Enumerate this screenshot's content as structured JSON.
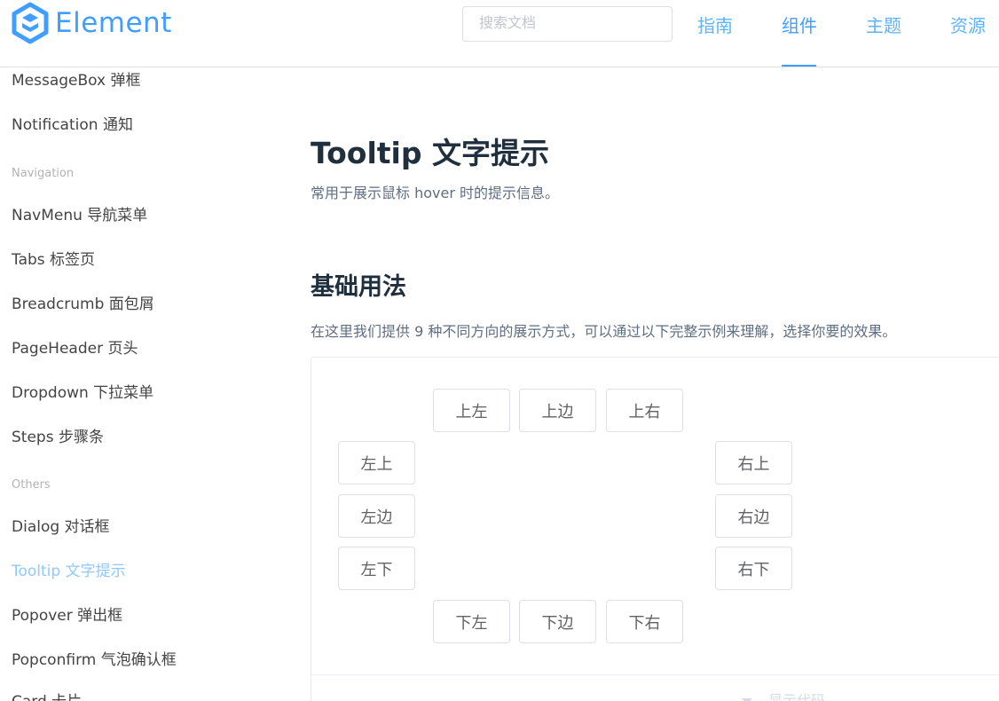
{
  "header": {
    "logo_text": "Element",
    "search_placeholder": "搜索文档",
    "nav": [
      "指南",
      "组件",
      "主题",
      "资源"
    ],
    "active_nav": "组件"
  },
  "sidebar": {
    "items": [
      {
        "type": "link",
        "label": "MessageBox 弹框"
      },
      {
        "type": "link",
        "label": "Notification 通知"
      },
      {
        "type": "group",
        "label": "Navigation"
      },
      {
        "type": "link",
        "label": "NavMenu 导航菜单"
      },
      {
        "type": "link",
        "label": "Tabs 标签页"
      },
      {
        "type": "link",
        "label": "Breadcrumb 面包屑"
      },
      {
        "type": "link",
        "label": "PageHeader 页头"
      },
      {
        "type": "link",
        "label": "Dropdown 下拉菜单"
      },
      {
        "type": "link",
        "label": "Steps 步骤条"
      },
      {
        "type": "group",
        "label": "Others"
      },
      {
        "type": "link",
        "label": "Dialog 对话框"
      },
      {
        "type": "link",
        "label": "Tooltip 文字提示",
        "active": true
      },
      {
        "type": "link",
        "label": "Popover 弹出框"
      },
      {
        "type": "link",
        "label": "Popconfirm 气泡确认框"
      },
      {
        "type": "link",
        "label": "Card 卡片"
      }
    ]
  },
  "main": {
    "title": "Tooltip 文字提示",
    "description": "常用于展示鼠标 hover 时的提示信息。",
    "section_title": "基础用法",
    "section_description": "在这里我们提供 9 种不同方向的展示方式，可以通过以下完整示例来理解，选择你要的效果。",
    "buttons": {
      "top_start": "上左",
      "top": "上边",
      "top_end": "上右",
      "left_start": "左上",
      "left": "左边",
      "left_end": "左下",
      "right_start": "右上",
      "right": "右边",
      "right_end": "右下",
      "bottom_start": "下左",
      "bottom": "下边",
      "bottom_end": "下右"
    },
    "show_code": "显示代码"
  },
  "colors": {
    "accent": "#409eff",
    "text": "#1f2f3d",
    "muted": "#5e6d82"
  }
}
